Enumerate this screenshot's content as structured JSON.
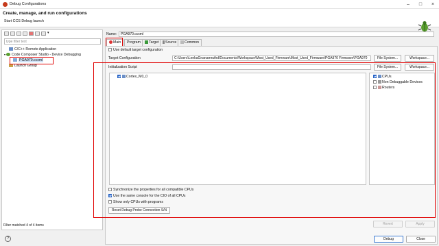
{
  "window": {
    "title": "Debug Configurations"
  },
  "header": {
    "title": "Create, manage, and run configurations",
    "subtitle": "Start CCS Debug launch"
  },
  "left": {
    "filter_placeholder": "type filter text",
    "tree": [
      {
        "label": "C/C++ Remote Application",
        "level": 1
      },
      {
        "label": "Code Composer Studio - Device Debugging",
        "level": 0,
        "expanded": true
      },
      {
        "label": "PGA970.ccxml",
        "level": 2,
        "selected": true
      },
      {
        "label": "Launch Group",
        "level": 1
      }
    ],
    "status": "Filter matched 4 of 4 items"
  },
  "config": {
    "name_label": "Name:",
    "name_value": "PGA970.ccxml",
    "tabs": [
      "Main",
      "Program",
      "Target",
      "Source",
      "Common"
    ],
    "active_tab": "Main",
    "use_default_target": "Use default target configuration",
    "target_config_label": "Target Configuration",
    "target_config_value": "C:\\Users\\LenkaGnanamruthd\\Documents\\Workspace\\Most_Used_Firmware\\Most_Used_Firmware\\PGA970 Firmware\\PGA970",
    "file_system": "File System...",
    "workspace": "Workspace...",
    "init_script_label": "Initialization Script",
    "cpu_tree": [
      {
        "label": "Cortex_M0_0",
        "checked": true
      }
    ],
    "filters": [
      {
        "label": "CPUs",
        "checked": true
      },
      {
        "label": "Non Debuggable Devices",
        "checked": false
      },
      {
        "label": "Routers",
        "checked": false
      }
    ],
    "options": [
      {
        "label": "Synchronize the properties for all compatible CPUs",
        "checked": false
      },
      {
        "label": "Use the same console for the CIO of all CPUs",
        "checked": true
      },
      {
        "label": "Show only CPUs with programs",
        "checked": false
      }
    ],
    "reset_button": "Reset Debug Probe Connection S/N",
    "revert": "Revert",
    "apply": "Apply"
  },
  "footer": {
    "help": "?",
    "debug": "Debug",
    "close": "Close"
  },
  "colors": {
    "highlight": "#e00000",
    "accent": "#2a66c8"
  }
}
